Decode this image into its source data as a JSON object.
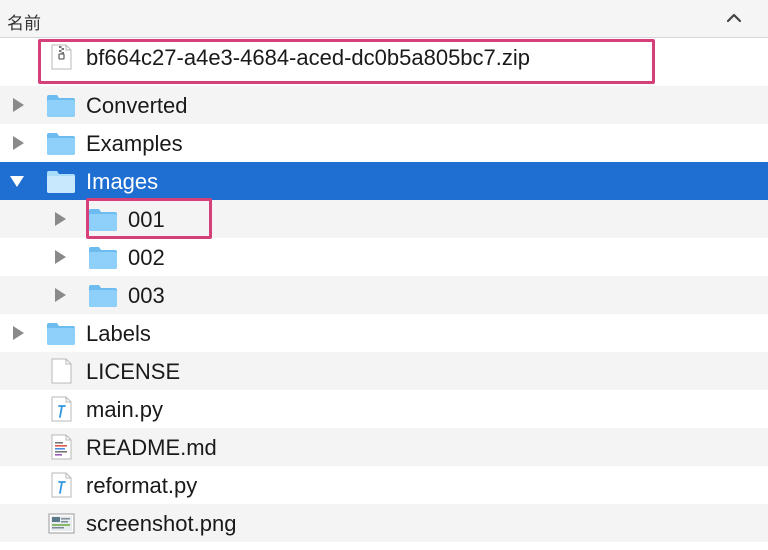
{
  "header": {
    "column_name": "名前",
    "sort_icon": "chevron-up-icon"
  },
  "rows": [
    {
      "name": "bf664c27-a4e3-4684-aced-dc0b5a805bc7.zip",
      "kind": "zip-file",
      "icon": "zip-file-icon",
      "disclosure": "none",
      "selected": false,
      "highlighted": true
    },
    {
      "name": "Converted",
      "kind": "folder",
      "icon": "folder-icon",
      "disclosure": "collapsed",
      "selected": false
    },
    {
      "name": "Examples",
      "kind": "folder",
      "icon": "folder-icon",
      "disclosure": "collapsed",
      "selected": false
    },
    {
      "name": "Images",
      "kind": "folder",
      "icon": "folder-icon",
      "disclosure": "expanded",
      "selected": true
    },
    {
      "name": "001",
      "kind": "folder",
      "icon": "folder-icon",
      "disclosure": "collapsed",
      "selected": false,
      "highlighted": true,
      "parent": "Images"
    },
    {
      "name": "002",
      "kind": "folder",
      "icon": "folder-icon",
      "disclosure": "collapsed",
      "selected": false,
      "parent": "Images"
    },
    {
      "name": "003",
      "kind": "folder",
      "icon": "folder-icon",
      "disclosure": "collapsed",
      "selected": false,
      "parent": "Images"
    },
    {
      "name": "Labels",
      "kind": "folder",
      "icon": "folder-icon",
      "disclosure": "collapsed",
      "selected": false
    },
    {
      "name": "LICENSE",
      "kind": "file",
      "icon": "blank-document-icon",
      "disclosure": "none",
      "selected": false
    },
    {
      "name": "main.py",
      "kind": "python-file",
      "icon": "python-file-icon",
      "disclosure": "none",
      "selected": false
    },
    {
      "name": "README.md",
      "kind": "markdown-file",
      "icon": "text-document-icon",
      "disclosure": "none",
      "selected": false
    },
    {
      "name": "reformat.py",
      "kind": "python-file",
      "icon": "python-file-icon",
      "disclosure": "none",
      "selected": false
    },
    {
      "name": "screenshot.png",
      "kind": "image-file",
      "icon": "image-file-icon",
      "disclosure": "none",
      "selected": false
    }
  ],
  "colors": {
    "selection": "#1f6fd2",
    "highlight_box": "#d6407a",
    "folder": "#6cbcf0",
    "alt_row": "#f4f4f4"
  }
}
